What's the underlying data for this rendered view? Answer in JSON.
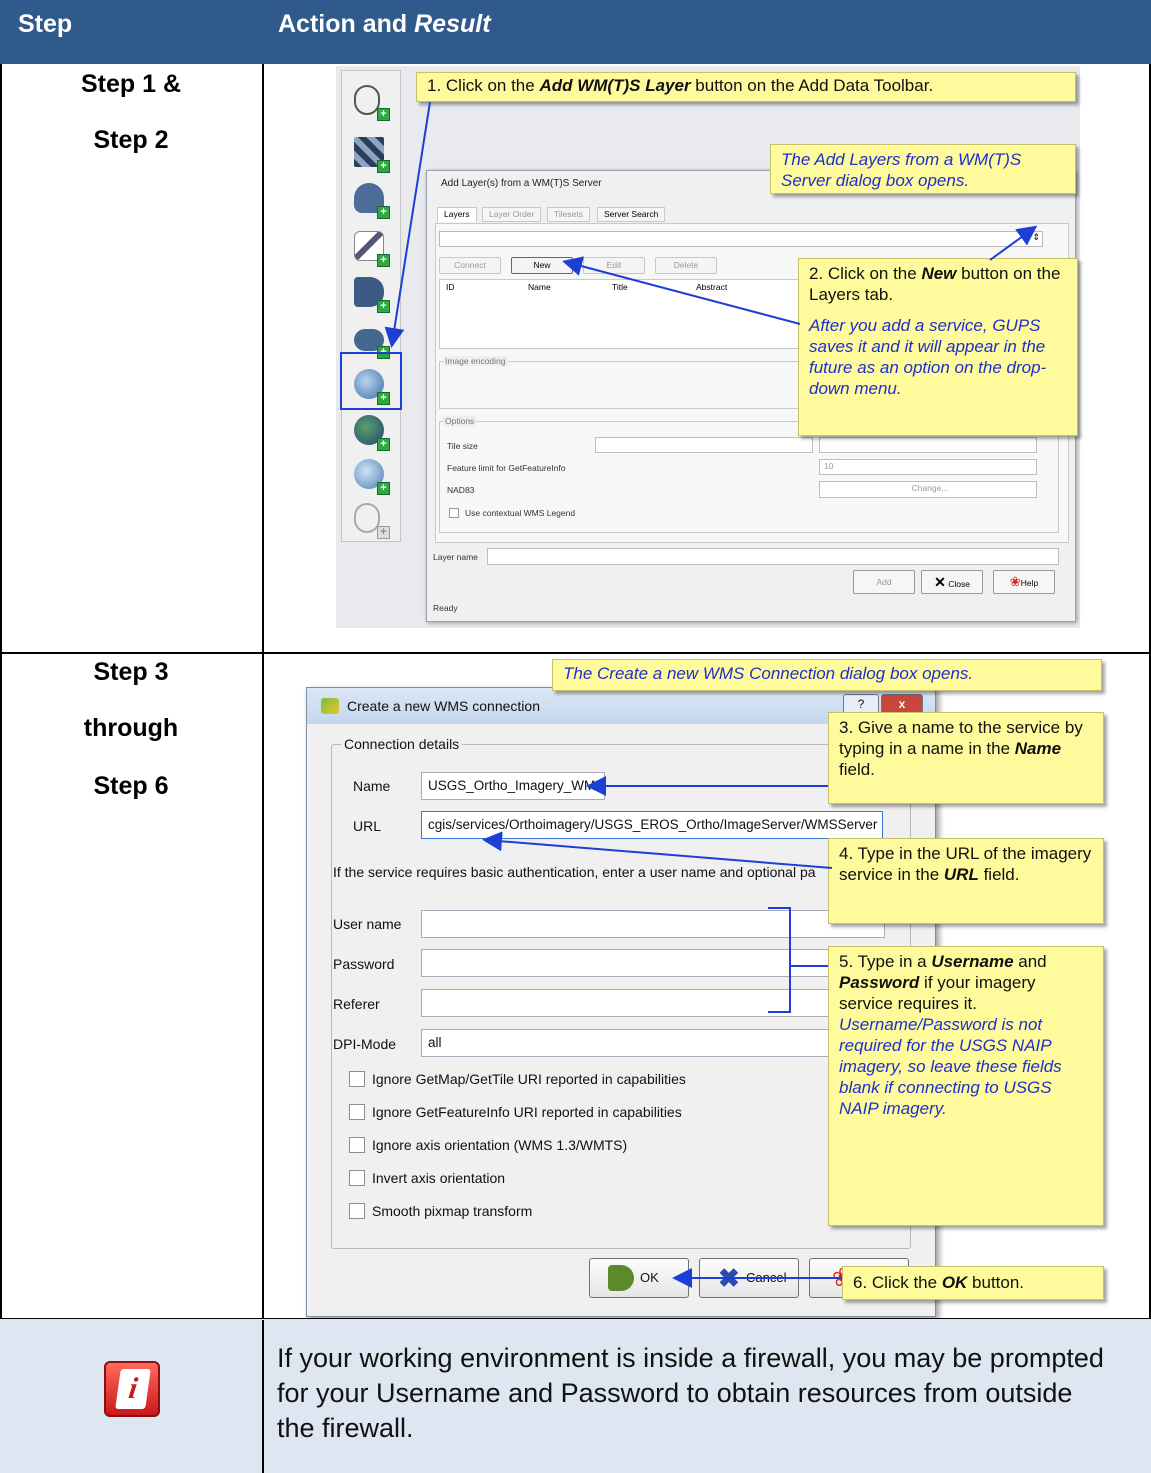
{
  "header": {
    "col1": "Step",
    "col2_prefix": "Action and ",
    "col2_italic": "Result"
  },
  "rows": {
    "r1": {
      "line1": "Step 1 &",
      "line2": "Step 2"
    },
    "r2": {
      "line1": "Step 3",
      "line2": "through",
      "line3": "Step 6"
    }
  },
  "callouts": {
    "c1": {
      "pre": "1. Click on the ",
      "bold": "Add WM(T)S Layer",
      "post": " button on the Add Data Toolbar."
    },
    "c2": {
      "text": "The Add Layers from a WM(T)S Server dialog box opens."
    },
    "c3": {
      "pre": "2.  Click on the ",
      "bold": "New",
      "post": " button on the Layers tab.",
      "blue": "After you add a service, GUPS saves it and it will appear in the future as an option on the drop- down menu."
    },
    "c4": {
      "text": "The Create a new WMS Connection dialog box opens."
    },
    "c5": {
      "pre": "3.  Give a name to the service by typing in a name in the ",
      "bold": "Name",
      "post": " field."
    },
    "c6": {
      "pre": "4.  Type in the URL of the imagery service in the ",
      "bold": "URL",
      "post": " field."
    },
    "c7": {
      "pre": "5.  Type in a ",
      "bold1": "Username",
      "mid": " and ",
      "bold2": "Password",
      "post": "  if your imagery service requires it. ",
      "blue": "Username/Password is not required for the USGS NAIP imagery, so leave these fields blank if connecting to USGS NAIP imagery."
    },
    "c8": {
      "pre": "6.  Click the ",
      "bold": "OK",
      "post": " button."
    }
  },
  "dialog1": {
    "title": "Add Layer(s) from a WM(T)S Server",
    "tabs": [
      "Layers",
      "Layer Order",
      "Tilesets",
      "Server Search"
    ],
    "buttons": [
      "Connect",
      "New",
      "Edit",
      "Delete"
    ],
    "columns": [
      "ID",
      "Name",
      "Title",
      "Abstract"
    ],
    "image_encoding": "Image encoding",
    "options": "Options",
    "tile_size": "Tile size",
    "feature_limit": "Feature limit for GetFeatureInfo",
    "feature_limit_value": "10",
    "crs": "NAD83",
    "change": "Change...",
    "legend": "Use contextual WMS Legend",
    "layer_name": "Layer name",
    "add": "Add",
    "close": "Close",
    "help": "Help",
    "status": "Ready"
  },
  "dialog2": {
    "title": "Create a new WMS connection",
    "help_btn": "?",
    "close_btn": "x",
    "group": "Connection details",
    "name_label": "Name",
    "name_value": "USGS_Ortho_Imagery_WMS",
    "url_label": "URL",
    "url_value": "cgis/services/Orthoimagery/USGS_EROS_Ortho/ImageServer/WMSServer",
    "auth_note": "If the service requires basic authentication, enter a user name and optional pa",
    "user_label": "User name",
    "password_label": "Password",
    "referer_label": "Referer",
    "dpi_label": "DPI-Mode",
    "dpi_value": "all",
    "checks": [
      "Ignore GetMap/GetTile URI reported in capabilities",
      "Ignore GetFeatureInfo URI reported in capabilities",
      "Ignore axis orientation (WMS 1.3/WMTS)",
      "Invert axis orientation",
      "Smooth pixmap transform"
    ],
    "ok": "OK",
    "cancel": "Cancel"
  },
  "note": "If your working environment is inside a firewall, you may be prompted for your Username and Password to obtain resources from outside the firewall.",
  "colors": {
    "header": "#2f5a8b",
    "callout": "#fffb9c",
    "arrow": "#1d3fd6",
    "note_bg": "#dde6f1"
  },
  "icons": [
    "add-vector-layer-icon",
    "add-raster-layer-icon",
    "add-postgis-layer-icon",
    "add-spatialite-layer-icon",
    "add-mssql-layer-icon",
    "add-oracle-layer-icon",
    "add-wms-layer-icon",
    "add-wcs-layer-icon",
    "add-wfs-layer-icon",
    "new-shapefile-icon",
    "info-icon",
    "ok-check-icon",
    "cancel-x-icon",
    "help-lifebuoy-icon"
  ]
}
